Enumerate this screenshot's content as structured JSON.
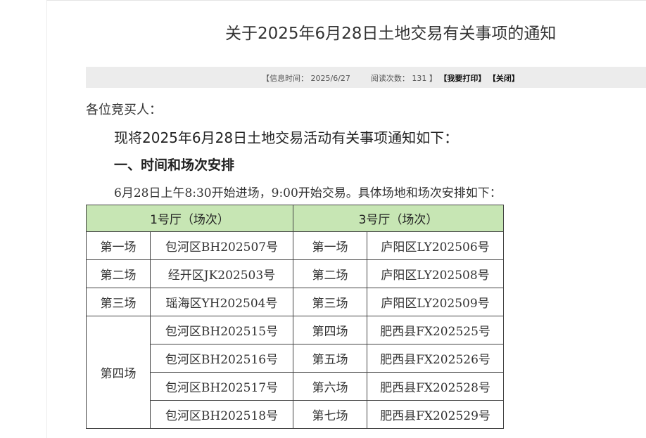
{
  "notice": {
    "title": "关于2025年6月28日土地交易有关事项的通知",
    "info": {
      "time_label": "【信息时间：",
      "time_value": "2025/6/27",
      "reads_label": "阅读次数：",
      "reads_value": "131",
      "close_bracket": "】",
      "print_label": "【我要打印】",
      "close_label": "【关闭】"
    },
    "salutation": "各位竞买人：",
    "intro": "现将2025年6月28日土地交易活动有关事项通知如下：",
    "section1": "一、时间和场次安排",
    "schedule": "6月28日上午8:30开始进场，9:00开始交易。具体场地和场次安排如下："
  },
  "table": {
    "headers": [
      "1号厅（场次）",
      "3号厅（场次）"
    ],
    "rows": [
      [
        "第一场",
        "包河区BH202507号",
        "第一场",
        "庐阳区LY202506号"
      ],
      [
        "第二场",
        "经开区JK202503号",
        "第二场",
        "庐阳区LY202508号"
      ],
      [
        "第三场",
        "瑶海区YH202504号",
        "第三场",
        "庐阳区LY202509号"
      ],
      [
        "第四场",
        "包河区BH202515号",
        "第四场",
        "肥西县FX202525号"
      ],
      [
        "",
        "包河区BH202516号",
        "第五场",
        "肥西县FX202526号"
      ],
      [
        "",
        "包河区BH202517号",
        "第六场",
        "肥西县FX202528号"
      ],
      [
        "",
        "包河区BH202518号",
        "第七场",
        "肥西县FX202529号"
      ]
    ]
  }
}
